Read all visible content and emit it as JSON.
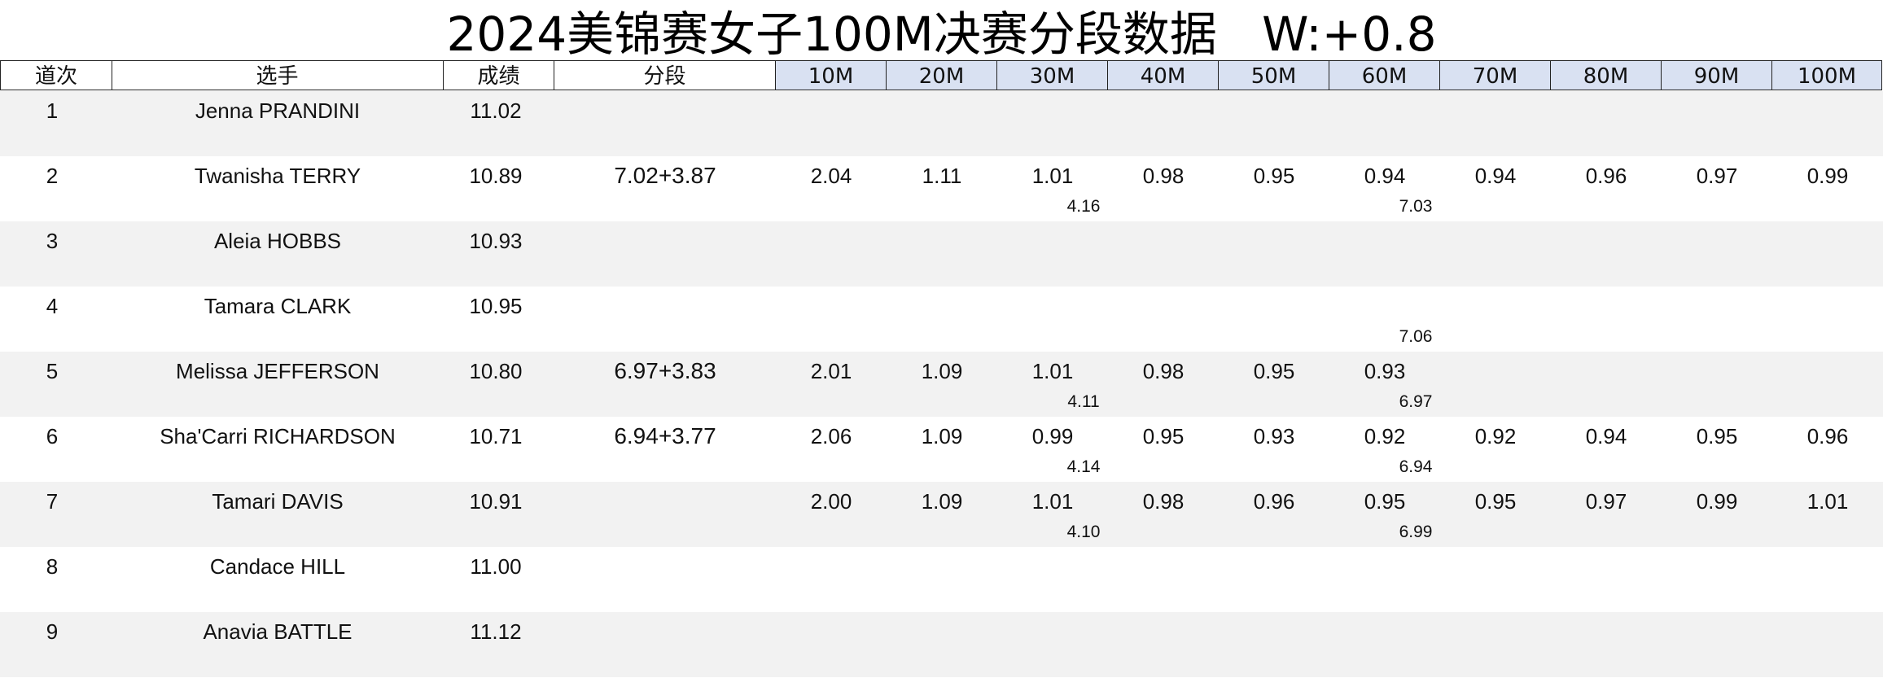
{
  "title": "2024美锦赛女子100M决赛分段数据   W:+0.8",
  "headers": {
    "lane": "道次",
    "athlete": "选手",
    "result": "成绩",
    "segment": "分段",
    "splits": [
      "10M",
      "20M",
      "30M",
      "40M",
      "50M",
      "60M",
      "70M",
      "80M",
      "90M",
      "100M"
    ]
  },
  "rows": [
    {
      "lane": "1",
      "athlete": "Jenna PRANDINI",
      "result": "11.02",
      "segment": "",
      "splits": [
        "",
        "",
        "",
        "",
        "",
        "",
        "",
        "",
        "",
        ""
      ],
      "sub30": "",
      "sub60": ""
    },
    {
      "lane": "2",
      "athlete": "Twanisha TERRY",
      "result": "10.89",
      "segment": "7.02+3.87",
      "splits": [
        "2.04",
        "1.11",
        "1.01",
        "0.98",
        "0.95",
        "0.94",
        "0.94",
        "0.96",
        "0.97",
        "0.99"
      ],
      "sub30": "4.16",
      "sub60": "7.03"
    },
    {
      "lane": "3",
      "athlete": "Aleia HOBBS",
      "result": "10.93",
      "segment": "",
      "splits": [
        "",
        "",
        "",
        "",
        "",
        "",
        "",
        "",
        "",
        ""
      ],
      "sub30": "",
      "sub60": ""
    },
    {
      "lane": "4",
      "athlete": "Tamara CLARK",
      "result": "10.95",
      "segment": "",
      "splits": [
        "",
        "",
        "",
        "",
        "",
        "",
        "",
        "",
        "",
        ""
      ],
      "sub30": "",
      "sub60": "7.06"
    },
    {
      "lane": "5",
      "athlete": "Melissa JEFFERSON",
      "result": "10.80",
      "segment": "6.97+3.83",
      "splits": [
        "2.01",
        "1.09",
        "1.01",
        "0.98",
        "0.95",
        "0.93",
        "",
        "",
        "",
        ""
      ],
      "sub30": "4.11",
      "sub60": "6.97"
    },
    {
      "lane": "6",
      "athlete": "Sha'Carri RICHARDSON",
      "result": "10.71",
      "segment": "6.94+3.77",
      "splits": [
        "2.06",
        "1.09",
        "0.99",
        "0.95",
        "0.93",
        "0.92",
        "0.92",
        "0.94",
        "0.95",
        "0.96"
      ],
      "sub30": "4.14",
      "sub60": "6.94"
    },
    {
      "lane": "7",
      "athlete": "Tamari DAVIS",
      "result": "10.91",
      "segment": "",
      "splits": [
        "2.00",
        "1.09",
        "1.01",
        "0.98",
        "0.96",
        "0.95",
        "0.95",
        "0.97",
        "0.99",
        "1.01"
      ],
      "sub30": "4.10",
      "sub60": "6.99"
    },
    {
      "lane": "8",
      "athlete": "Candace HILL",
      "result": "11.00",
      "segment": "",
      "splits": [
        "",
        "",
        "",
        "",
        "",
        "",
        "",
        "",
        "",
        ""
      ],
      "sub30": "",
      "sub60": ""
    },
    {
      "lane": "9",
      "athlete": "Anavia BATTLE",
      "result": "11.12",
      "segment": "",
      "splits": [
        "",
        "",
        "",
        "",
        "",
        "",
        "",
        "",
        "",
        ""
      ],
      "sub30": "",
      "sub60": ""
    }
  ],
  "colors": {
    "split_header_bg": "#d9e1f2",
    "odd_row_bg": "#f2f2f2",
    "even_row_bg": "#ffffff"
  }
}
